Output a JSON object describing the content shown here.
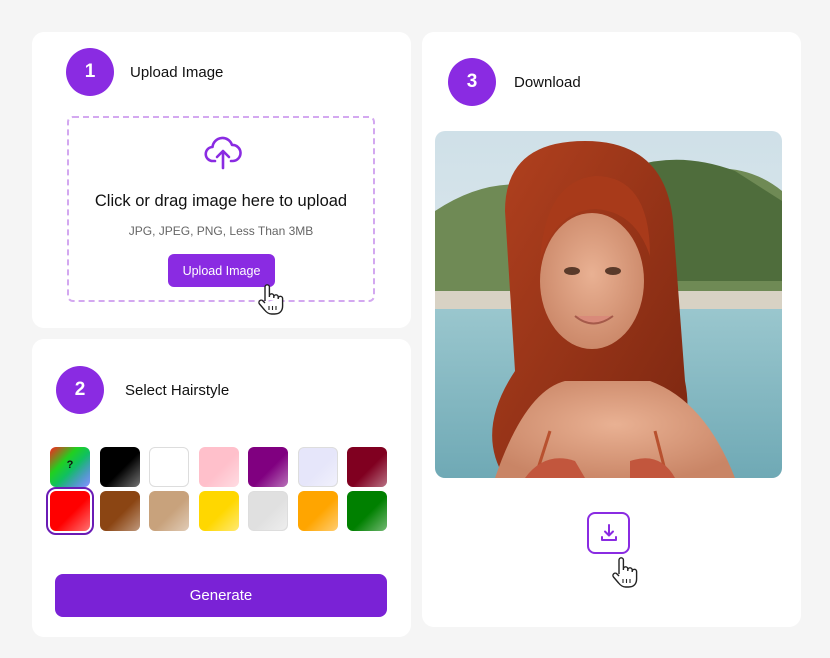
{
  "steps": {
    "upload": {
      "number": "1",
      "label": "Upload Image"
    },
    "style": {
      "number": "2",
      "label": "Select Hairstyle"
    },
    "download": {
      "number": "3",
      "label": "Download"
    }
  },
  "upload": {
    "title": "Click or drag image here to upload",
    "hint": "JPG, JPEG, PNG, Less Than 3MB",
    "button_label": "Upload Image",
    "icon": "cloud-upload-icon"
  },
  "hairstyle": {
    "swatches": [
      {
        "name": "random",
        "color": "#00ff00",
        "label": "?"
      },
      {
        "name": "black",
        "color": "#000000"
      },
      {
        "name": "white",
        "color": "#ffffff"
      },
      {
        "name": "pink",
        "color": "#ffc0cb"
      },
      {
        "name": "purple",
        "color": "#800080"
      },
      {
        "name": "lavender",
        "color": "#e6e6fa"
      },
      {
        "name": "maroon",
        "color": "#800020"
      },
      {
        "name": "red",
        "color": "#ff0000",
        "selected": true
      },
      {
        "name": "brown",
        "color": "#8b4513"
      },
      {
        "name": "tan",
        "color": "#c8a27c"
      },
      {
        "name": "gold",
        "color": "#ffd700"
      },
      {
        "name": "silver",
        "color": "#e0e0e0"
      },
      {
        "name": "orange",
        "color": "#ffa500"
      },
      {
        "name": "green",
        "color": "#008000"
      }
    ],
    "generate_label": "Generate"
  },
  "download": {
    "icon": "download-icon",
    "image_alt_subject": "red-haired woman on a beach"
  },
  "colors": {
    "accent": "#8a2be2",
    "accent_dark": "#7a22d6",
    "dashed_border": "#d3a8f0"
  }
}
